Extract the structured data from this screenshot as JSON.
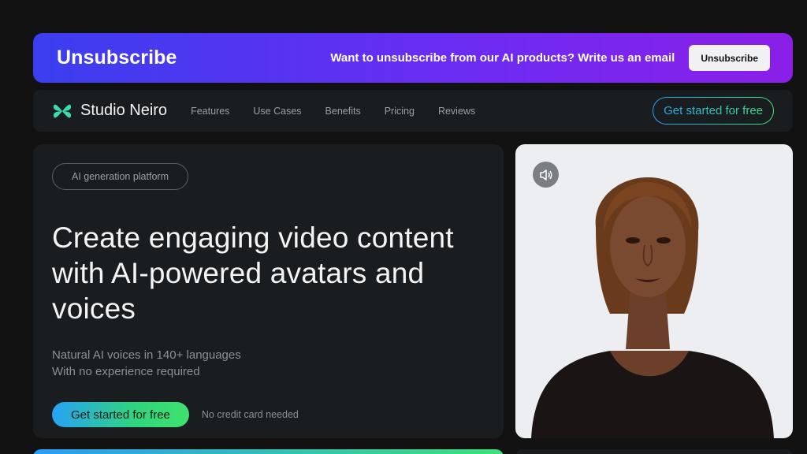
{
  "banner": {
    "title": "Unsubscribe",
    "message": "Want to unsubscribe from our AI products? Write us an email",
    "button_label": "Unsubscribe",
    "gradient": [
      "#3b3ef0",
      "#8b1fe8"
    ]
  },
  "nav": {
    "brand": "Studio Neiro",
    "links": [
      "Features",
      "Use Cases",
      "Benefits",
      "Pricing",
      "Reviews"
    ],
    "cta_label": "Get started for free"
  },
  "hero": {
    "tag": "AI generation platform",
    "title": "Create engaging video content with AI-powered avatars and voices",
    "subtitle_line1": "Natural AI voices in 140+ languages",
    "subtitle_line2": "With no experience required",
    "cta_label": "Get started for free",
    "note": "No credit card needed"
  },
  "video": {
    "sound_icon": "speaker-icon"
  },
  "colors": {
    "background": "#121212",
    "card": "#1a1d20",
    "accent_blue": "#2a9df4",
    "accent_green": "#3ee07a",
    "logo": "#3fd9b0"
  }
}
